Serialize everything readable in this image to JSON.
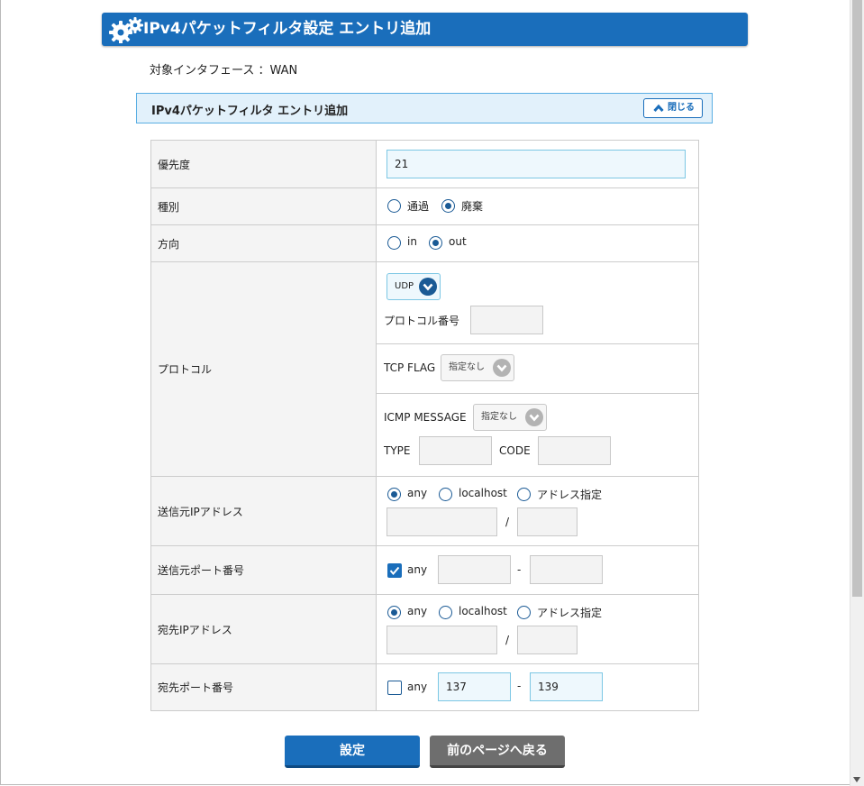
{
  "header": {
    "title": "IPv4パケットフィルタ設定 エントリ追加"
  },
  "interface": {
    "label": "対象インタフェース ：WAN"
  },
  "section": {
    "title": "IPv4パケットフィルタ エントリ追加",
    "close_label": "閉じる"
  },
  "form": {
    "priority": {
      "label": "優先度",
      "value": "21"
    },
    "type": {
      "label": "種別",
      "options": [
        "通過",
        "廃棄"
      ],
      "selected": "廃棄"
    },
    "direction": {
      "label": "方向",
      "options": [
        "in",
        "out"
      ],
      "selected": "out"
    },
    "protocol": {
      "label": "プロトコル",
      "selected": "UDP",
      "number_label": "プロトコル番号",
      "number_value": "",
      "tcp_flag_label": "TCP FLAG",
      "tcp_flag_value": "指定なし",
      "icmp_label": "ICMP MESSAGE",
      "icmp_value": "指定なし",
      "type_label": "TYPE",
      "code_label": "CODE"
    },
    "src_ip": {
      "label": "送信元IPアドレス",
      "options": [
        "any",
        "localhost",
        "アドレス指定"
      ],
      "selected": "any",
      "slash": "/"
    },
    "src_port": {
      "label": "送信元ポート番号",
      "any_label": "any",
      "any_checked": true,
      "from": "",
      "to": "",
      "dash": "-"
    },
    "dst_ip": {
      "label": "宛先IPアドレス",
      "options": [
        "any",
        "localhost",
        "アドレス指定"
      ],
      "selected": "any",
      "slash": "/"
    },
    "dst_port": {
      "label": "宛先ポート番号",
      "any_label": "any",
      "any_checked": false,
      "from": "137",
      "to": "139",
      "dash": "-"
    }
  },
  "buttons": {
    "submit": "設定",
    "back": "前のページへ戻る"
  },
  "colors": {
    "primary": "#1a6ebb",
    "section_bg": "#e2f1fb",
    "secondary_button": "#6e6e6e"
  }
}
